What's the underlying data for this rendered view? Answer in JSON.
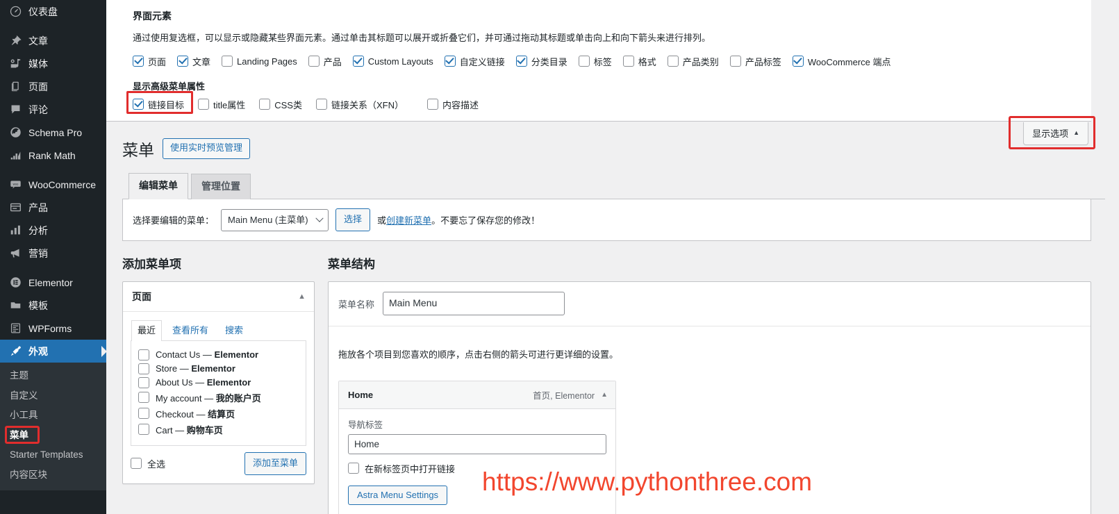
{
  "sidebar": {
    "items": [
      {
        "label": "仪表盘",
        "icon": "dashboard-icon",
        "current": false,
        "sep_after": true
      },
      {
        "label": "文章",
        "icon": "pin-icon",
        "current": false,
        "sep_after": false
      },
      {
        "label": "媒体",
        "icon": "media-icon",
        "current": false,
        "sep_after": false
      },
      {
        "label": "页面",
        "icon": "pages-icon",
        "current": false,
        "sep_after": false
      },
      {
        "label": "评论",
        "icon": "comments-icon",
        "current": false,
        "sep_after": false
      },
      {
        "label": "Schema Pro",
        "icon": "globe-icon",
        "current": false,
        "sep_after": false
      },
      {
        "label": "Rank Math",
        "icon": "rankmath-icon",
        "current": false,
        "sep_after": true
      },
      {
        "label": "WooCommerce",
        "icon": "woo-icon",
        "current": false,
        "sep_after": false
      },
      {
        "label": "产品",
        "icon": "product-icon",
        "current": false,
        "sep_after": false
      },
      {
        "label": "分析",
        "icon": "chart-icon",
        "current": false,
        "sep_after": false
      },
      {
        "label": "营销",
        "icon": "megaphone-icon",
        "current": false,
        "sep_after": true
      },
      {
        "label": "Elementor",
        "icon": "elementor-icon",
        "current": false,
        "sep_after": false
      },
      {
        "label": "模板",
        "icon": "folder-icon",
        "current": false,
        "sep_after": false
      },
      {
        "label": "WPForms",
        "icon": "wpforms-icon",
        "current": false,
        "sep_after": false
      },
      {
        "label": "外观",
        "icon": "appearance-brush-icon",
        "current": true,
        "sep_after": false
      }
    ],
    "submenu": {
      "items": [
        {
          "label": "主题",
          "current": false
        },
        {
          "label": "自定义",
          "current": false
        },
        {
          "label": "小工具",
          "current": false
        },
        {
          "label": "菜单",
          "current": true
        },
        {
          "label": "Starter Templates",
          "current": false
        },
        {
          "label": "内容区块",
          "current": false
        }
      ]
    }
  },
  "screen_options": {
    "toggle_label": "显示选项",
    "toggle_caret": "▲",
    "section_title": "界面元素",
    "section_desc": "通过使用复选框，可以显示或隐藏某些界面元素。通过单击其标题可以展开或折叠它们，并可通过拖动其标题或单击向上和向下箭头来进行排列。",
    "boxes": [
      {
        "label": "页面",
        "checked": true
      },
      {
        "label": "文章",
        "checked": true
      },
      {
        "label": "Landing Pages",
        "checked": false
      },
      {
        "label": "产品",
        "checked": false
      },
      {
        "label": "Custom Layouts",
        "checked": true
      },
      {
        "label": "自定义链接",
        "checked": true
      },
      {
        "label": "分类目录",
        "checked": true
      },
      {
        "label": "标签",
        "checked": false
      },
      {
        "label": "格式",
        "checked": false
      },
      {
        "label": "产品类别",
        "checked": false
      },
      {
        "label": "产品标签",
        "checked": false
      },
      {
        "label": "WooCommerce 端点",
        "checked": true
      }
    ],
    "advanced_title": "显示高级菜单属性",
    "advanced_boxes": [
      {
        "label": "链接目标",
        "checked": true,
        "highlighted": true
      },
      {
        "label": "title属性",
        "checked": false,
        "highlighted": false
      },
      {
        "label": "CSS类",
        "checked": false,
        "highlighted": false
      },
      {
        "label": "链接关系（XFN）",
        "checked": false,
        "highlighted": false
      },
      {
        "label": "内容描述",
        "checked": false,
        "highlighted": false
      }
    ]
  },
  "page": {
    "title": "菜单",
    "live_preview_button": "使用实时预览管理",
    "tabs": [
      {
        "label": "编辑菜单",
        "active": true
      },
      {
        "label": "管理位置",
        "active": false
      }
    ]
  },
  "menu_selector": {
    "label": "选择要编辑的菜单：",
    "selected": "Main Menu (主菜单)",
    "options": [
      "Main Menu (主菜单)"
    ],
    "select_button": "选择",
    "tail_prefix": "或",
    "tail_link": "创建新菜单",
    "tail_suffix": "。不要忘了保存您的修改！"
  },
  "add_items": {
    "heading": "添加菜单项",
    "panel_title": "页面",
    "panel_caret": "▲",
    "tabs": [
      {
        "label": "最近",
        "active": true
      },
      {
        "label": "查看所有",
        "active": false
      },
      {
        "label": "搜索",
        "active": false
      }
    ],
    "pages": [
      {
        "name": "Contact Us",
        "dash": " — ",
        "suffix": "Elementor",
        "checked": false
      },
      {
        "name": "Store",
        "dash": " — ",
        "suffix": "Elementor",
        "checked": false
      },
      {
        "name": "About Us",
        "dash": " — ",
        "suffix": "Elementor",
        "checked": false
      },
      {
        "name": "My account",
        "dash": " — ",
        "suffix": "我的账户页",
        "checked": false
      },
      {
        "name": "Checkout",
        "dash": " — ",
        "suffix": "结算页",
        "checked": false
      },
      {
        "name": "Cart",
        "dash": " — ",
        "suffix": "购物车页",
        "checked": false
      }
    ],
    "select_all_label": "全选",
    "select_all_checked": false,
    "add_button": "添加至菜单"
  },
  "structure": {
    "heading": "菜单结构",
    "name_label": "菜单名称",
    "name_value": "Main Menu",
    "hint": "拖放各个项目到您喜欢的顺序，点击右侧的箭头可进行更详细的设置。",
    "items": [
      {
        "title": "Home",
        "type_label": "首页, Elementor",
        "caret": "▲",
        "nav_label_label": "导航标签",
        "nav_label_value": "Home",
        "new_tab_label": "在新标签页中打开链接",
        "new_tab_checked": false,
        "astra_button": "Astra Menu Settings"
      }
    ]
  },
  "watermark": {
    "text": "https://www.pythonthree.com",
    "color": "#f2462e"
  },
  "colors": {
    "admin_bg": "#1d2327",
    "admin_submenu_bg": "#2c3338",
    "accent_blue": "#2271b1",
    "highlight_red": "#e12d2d",
    "page_bg": "#f0f0f1"
  }
}
